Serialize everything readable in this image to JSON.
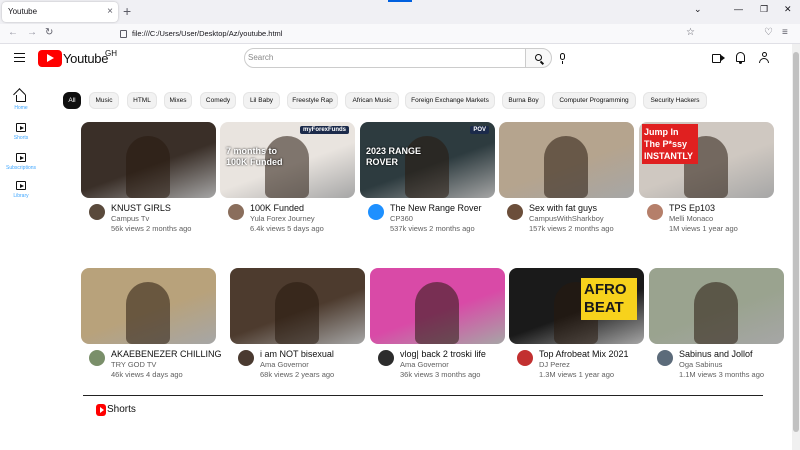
{
  "browser": {
    "tab_title": "Youtube",
    "tab_close": "×",
    "new_tab": "+",
    "address": "file:///C:/Users/User/Desktop/Az/youtube.html"
  },
  "header": {
    "logo_text": "Youtube",
    "logo_sup": "GH",
    "search_placeholder": "Search"
  },
  "sidebar": {
    "items": [
      {
        "label": "Home",
        "icon": "home-icon"
      },
      {
        "label": "Shorts",
        "icon": "shorts-icon"
      },
      {
        "label": "Subscriptions",
        "icon": "subscriptions-icon"
      },
      {
        "label": "Library",
        "icon": "library-icon"
      }
    ]
  },
  "chips": [
    {
      "label": "All",
      "active": true
    },
    {
      "label": "Music"
    },
    {
      "label": "HTML"
    },
    {
      "label": "Mixes"
    },
    {
      "label": "Comedy"
    },
    {
      "label": "Lil Baby"
    },
    {
      "label": "Freestyle Rap"
    },
    {
      "label": "African Music"
    },
    {
      "label": "Foreign Exchange Markets"
    },
    {
      "label": "Burna Boy"
    },
    {
      "label": "Computer Programming"
    },
    {
      "label": "Security Hackers"
    }
  ],
  "videos": [
    {
      "title": "KNUST GIRLS",
      "channel": "Campus Tv",
      "meta": "56k views 2 months ago",
      "thumb_color": "#3a2f28",
      "thumb_text": ""
    },
    {
      "title": "100K Funded",
      "channel": "Yula Forex Journey",
      "meta": "6.4k views 5 days ago",
      "thumb_color": "#e9e4df",
      "thumb_text": "7 months to 100K Funded",
      "thumb_tag": "myForexFunds"
    },
    {
      "title": "The New Range Rover",
      "channel": "CP360",
      "meta": "537k views 2 months ago",
      "thumb_color": "#2d3b3f",
      "thumb_text": "2023 RANGE ROVER",
      "thumb_tag": "POV"
    },
    {
      "title": "Sex with fat guys",
      "channel": "CampusWithSharkboy",
      "meta": "157k views 2 months ago",
      "thumb_color": "#b5a48e",
      "thumb_text": ""
    },
    {
      "title": "TPS Ep103",
      "channel": "Melli Monaco",
      "meta": "1M views 1 year ago",
      "thumb_color": "#cfc8c1",
      "thumb_text": "Jump In The P*ssy INSTANTLY"
    },
    {
      "title": "AKAEBENEZER CHILLING",
      "channel": "TRY GOD TV",
      "meta": "46k views 4 days ago",
      "thumb_color": "#b8a27b",
      "thumb_text": ""
    },
    {
      "title": "i am NOT bisexual",
      "channel": "Ama Governor",
      "meta": "68k views 2 years ago",
      "thumb_color": "#4d3b2e",
      "thumb_text": ""
    },
    {
      "title": "vlog| back 2 troski life",
      "channel": "Ama Governor",
      "meta": "36k views 3 months ago",
      "thumb_color": "#d94aa7",
      "thumb_text": ""
    },
    {
      "title": "Top Afrobeat Mix 2021",
      "channel": "DJ Perez",
      "meta": "1.3M views 1 year ago",
      "thumb_color": "#1a1a1a",
      "thumb_text": "AFRO BEAT"
    },
    {
      "title": "Sabinus and Jollof",
      "channel": "Oga Sabinus",
      "meta": "1.1M views 3 months ago",
      "thumb_color": "#9aa38f",
      "thumb_text": ""
    }
  ],
  "sections": {
    "shorts_label": "Shorts"
  }
}
